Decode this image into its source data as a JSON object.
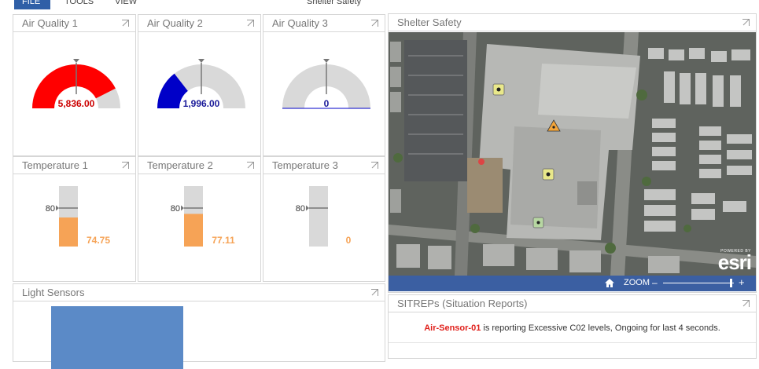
{
  "topbar": {
    "tabs": [
      "FILE",
      "TOOLS",
      "VIEW"
    ],
    "center_title": "Shelter Safety"
  },
  "gauges": [
    {
      "title": "Air Quality 1",
      "value_text": "5,836.00",
      "fraction": 0.85,
      "color": "#ff0000",
      "text_color": "#cc0000"
    },
    {
      "title": "Air Quality 2",
      "value_text": "1,996.00",
      "fraction": 0.29,
      "color": "#0000c8",
      "text_color": "#1a1a99"
    },
    {
      "title": "Air Quality 3",
      "value_text": "0",
      "fraction": 0,
      "color": "#0000c8",
      "text_color": "#1a1a99"
    }
  ],
  "thermometers": [
    {
      "title": "Temperature 1",
      "value_text": "74.75",
      "threshold_label": "80",
      "fill_fraction": 0.48,
      "color": "#f6a356"
    },
    {
      "title": "Temperature 2",
      "value_text": "77.11",
      "threshold_label": "80",
      "fill_fraction": 0.54,
      "color": "#f6a356"
    },
    {
      "title": "Temperature 3",
      "value_text": "0",
      "threshold_label": "80",
      "fill_fraction": 0,
      "color": "#f6a356"
    }
  ],
  "map_panel": {
    "title": "Shelter Safety",
    "zoom_label": "ZOOM",
    "zoom_minus": "–",
    "zoom_plus": "+",
    "attribution_small": "POWERED BY",
    "attribution_logo": "esri"
  },
  "light_sensors": {
    "title": "Light Sensors",
    "bar_color": "#5b8ac7"
  },
  "sitreps": {
    "title": "SITREPs (Situation Reports)",
    "sensor": "Air-Sensor-01",
    "message": " is reporting Excessive C02 levels, Ongoing for last 4 seconds."
  },
  "colors": {
    "accent": "#2f5fa7",
    "panel_border": "#d6d6d6",
    "gauge_track": "#d9d9d9"
  }
}
